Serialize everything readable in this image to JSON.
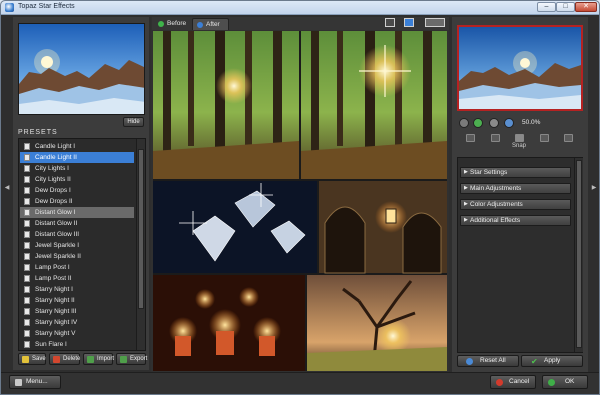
{
  "window": {
    "title": "Topaz Star Effects",
    "controls": {
      "minimize": "–",
      "maximize": "□",
      "close": "✕"
    }
  },
  "left_panel": {
    "hide_label": "Hide",
    "presets_heading": "PRESETS",
    "presets": [
      "Candle Light I",
      "Candle Light II",
      "City Lights I",
      "City Lights II",
      "Dew Drops I",
      "Dew Drops II",
      "Distant Glow I",
      "Distant Glow II",
      "Distant Glow III",
      "Jewel Sparkle I",
      "Jewel Sparkle II",
      "Lamp Post I",
      "Lamp Post II",
      "Starry Night I",
      "Starry Night II",
      "Starry Night III",
      "Starry Night IV",
      "Starry Night V",
      "Sun Flare I"
    ],
    "selected_preset": "Candle Light II",
    "highlighted_preset": "Distant Glow I",
    "buttons": {
      "save": "Save",
      "delete": "Delete",
      "import": "Import",
      "export": "Export"
    }
  },
  "center": {
    "tabs": {
      "before": "Before",
      "after": "After"
    }
  },
  "right_panel": {
    "zoom_value": "50.0%",
    "snap_label": "Snap",
    "sections": [
      "Star Settings",
      "Main Adjustments",
      "Color Adjustments",
      "Additional Effects"
    ],
    "reset_label": "Reset All",
    "apply_label": "Apply"
  },
  "bottom_bar": {
    "menu_label": "Menu...",
    "cancel_label": "Cancel",
    "ok_label": "OK"
  },
  "colors": {
    "selection": "#3b7fd6",
    "panel": "#3c3c3c",
    "dark": "#2e2e2e",
    "preview_border": "#b52222"
  }
}
